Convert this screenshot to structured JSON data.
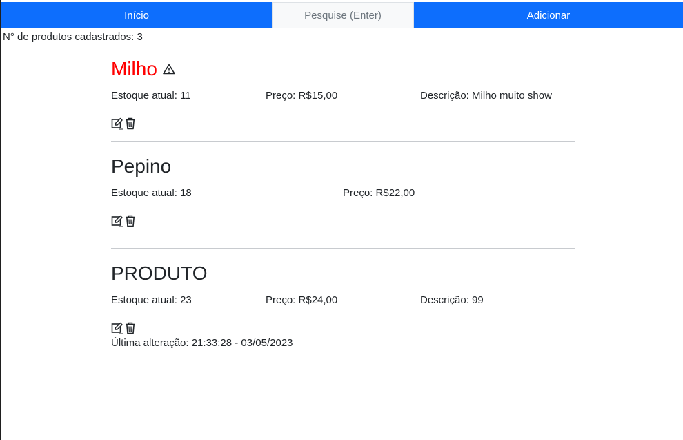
{
  "nav": {
    "home_label": "Início",
    "search_placeholder": "Pesquise (Enter)",
    "add_label": "Adicionar"
  },
  "summary": {
    "count_text": "N° de produtos cadastrados: 3"
  },
  "products": [
    {
      "name": "Milho",
      "stock": "Estoque atual: 11",
      "price": "Preço: R$15,00",
      "description": "Descrição: Milho muito show",
      "low_stock_warning": true
    },
    {
      "name": "Pepino",
      "stock": "Estoque atual: 18",
      "price": "Preço: R$22,00"
    },
    {
      "name": "PRODUTO",
      "stock": "Estoque atual: 23",
      "price": "Preço: R$24,00",
      "description": "Descrição: 99",
      "last_update": "Última alteração: 21:33:28 - 03/05/2023"
    }
  ],
  "colors": {
    "primary": "#0d6efd",
    "alert": "#ff0000",
    "text": "#212529"
  }
}
